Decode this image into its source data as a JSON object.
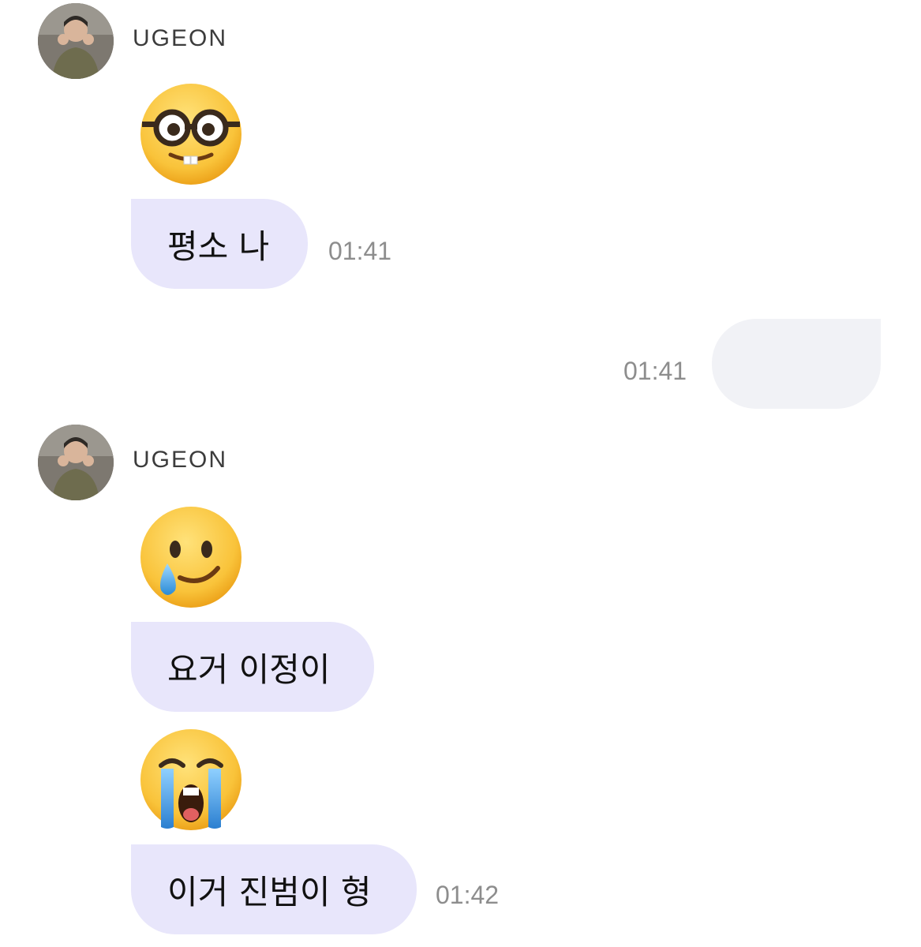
{
  "messages": [
    {
      "sender": "UGEON",
      "emoji": "nerd-face-icon",
      "text": "평소 나",
      "time": "01:41"
    },
    {
      "outgoing_time": "01:41"
    },
    {
      "sender": "UGEON",
      "emoji": "smiling-face-with-tear-icon",
      "text": "요거 이정이"
    },
    {
      "emoji": "loudly-crying-face-icon",
      "text": "이거 진범이 형",
      "time": "01:42"
    }
  ],
  "colors": {
    "incoming_bubble": "#e8e6fb",
    "outgoing_bubble": "#f1f2f6",
    "time_text": "#8d8d8d"
  }
}
